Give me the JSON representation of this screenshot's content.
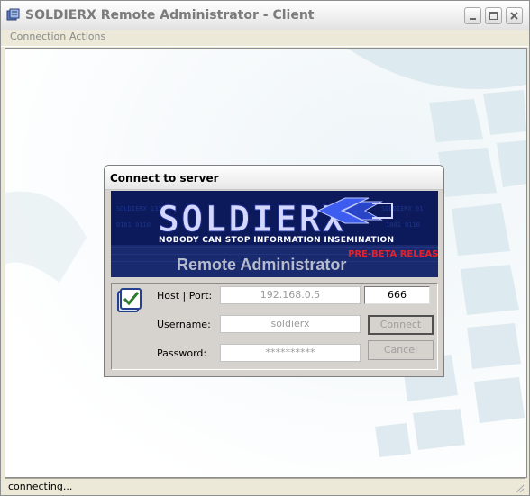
{
  "window": {
    "title": "SOLDIERX Remote Administrator - Client"
  },
  "menu": {
    "items": [
      "Connection",
      "Actions"
    ]
  },
  "dialog": {
    "title": "Connect to server",
    "banner": {
      "logo_text": "SOLDIERX",
      "tagline": "NOBODY CAN STOP INFORMATION INSEMINATION",
      "prerelease": "PRE-BETA RELEASE",
      "subtitle": "Remote Administrator"
    },
    "host_label": "Host | Port:",
    "host_value": "192.168.0.5",
    "port_value": "666",
    "username_label": "Username:",
    "username_value": "soldierx",
    "password_label": "Password:",
    "password_value": "**********",
    "connect_label": "Connect",
    "cancel_label": "Cancel"
  },
  "status": {
    "text": "connecting..."
  },
  "colors": {
    "banner_bg": "#0c1a5c",
    "prerelease": "#e8202a",
    "title_text": "#7b7b7b"
  }
}
